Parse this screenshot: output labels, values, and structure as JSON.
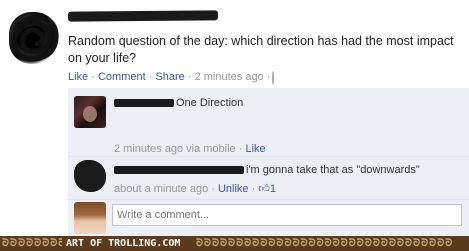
{
  "post": {
    "status": "Random question of the day: which direction has had the most impact on your life?",
    "actions": {
      "like": "Like",
      "sep1": " · ",
      "comment": "Comment",
      "sep2": " · ",
      "share": "Share",
      "sep3": " · ",
      "time": "2 minutes ago",
      "sep4": " · "
    }
  },
  "comments": [
    {
      "text": "One Direction",
      "time": "2 minutes ago via mobile",
      "sep": " · ",
      "like": "Like"
    },
    {
      "text": "i'm gonna take that as \"downwards\"",
      "time": "about a minute ago",
      "sep": " · ",
      "unlike": "Unlike",
      "sep2": " · ",
      "likes_count": "1"
    }
  ],
  "composer": {
    "placeholder": "Write a comment..."
  },
  "footer": {
    "watermark": "ART OF TROLLING.COM"
  },
  "colors": {
    "link": "#3b5998",
    "comment_bg": "#edeff4",
    "footer_bg": "#5a3b1e"
  }
}
